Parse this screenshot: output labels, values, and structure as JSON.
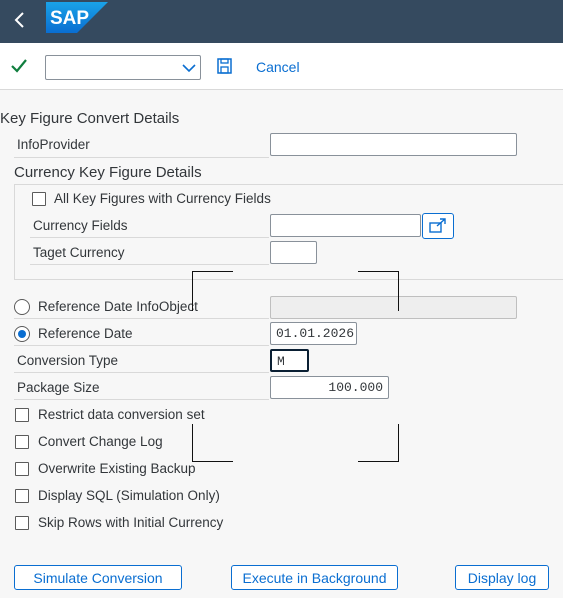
{
  "shell": {
    "logo_text": "SAP"
  },
  "toolbar": {
    "command_value": "",
    "cancel_label": "Cancel"
  },
  "form": {
    "title": "Key Figure Convert Details",
    "infoprovider_label": "InfoProvider",
    "infoprovider_value": "",
    "currency_section_title": "Currency Key Figure Details",
    "all_key_figures_label": "All Key Figures with Currency Fields",
    "all_key_figures_checked": false,
    "currency_fields_label": "Currency Fields",
    "currency_fields_value": "",
    "target_currency_label": "Taget Currency",
    "target_currency_value": "",
    "ref_date_infoobject_label": "Reference Date InfoObject",
    "ref_date_infoobject_value": "",
    "ref_date_label": "Reference Date",
    "ref_date_value": "01.01.2026",
    "ref_date_selected": true,
    "conversion_type_label": "Conversion Type",
    "conversion_type_value": "M",
    "package_size_label": "Package Size",
    "package_size_value": "100.000",
    "options": [
      {
        "label": "Restrict data conversion set",
        "checked": false
      },
      {
        "label": "Convert Change Log",
        "checked": false
      },
      {
        "label": "Overwrite Existing Backup",
        "checked": false
      },
      {
        "label": "Display SQL (Simulation Only)",
        "checked": false
      },
      {
        "label": "Skip Rows with Initial Currency",
        "checked": false
      }
    ]
  },
  "footer": {
    "simulate_label": "Simulate Conversion",
    "background_label": "Execute in Background",
    "log_label": "Display log"
  },
  "colors": {
    "shell": "#354a5f",
    "accent": "#0a6ed1",
    "check": "#107e3e"
  },
  "icons": [
    "back-arrow-icon",
    "sap-logo",
    "checkmark-icon",
    "chevron-down-icon",
    "save-icon",
    "value-help-icon"
  ]
}
